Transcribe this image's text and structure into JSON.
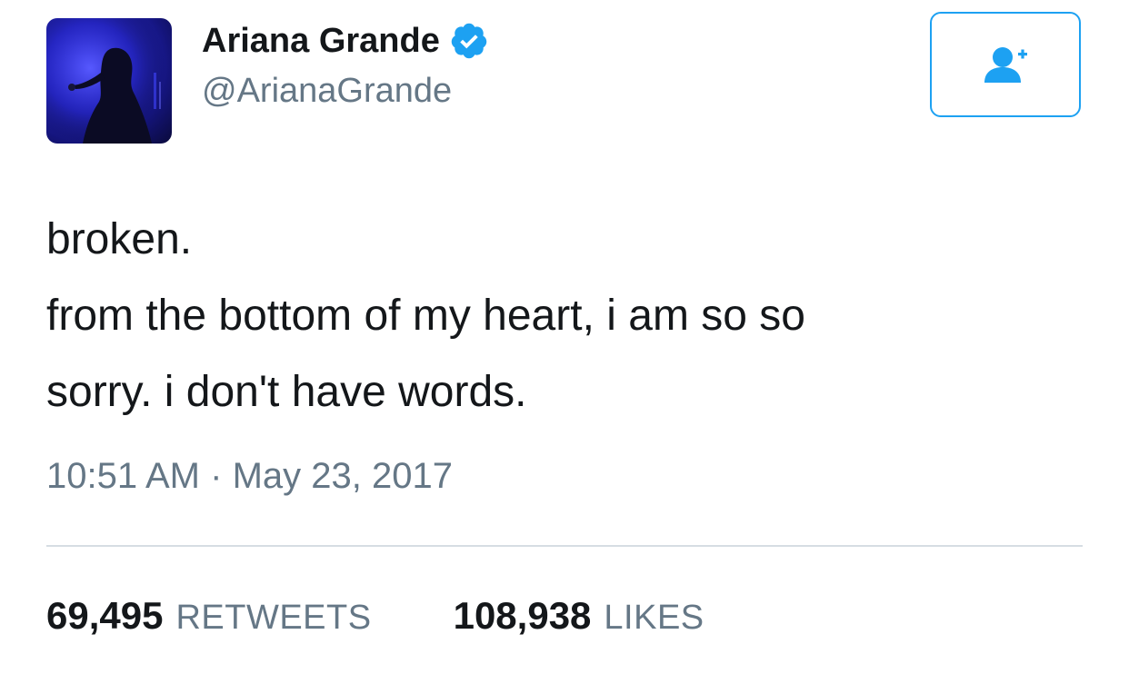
{
  "user": {
    "display_name": "Ariana Grande",
    "handle": "@ArianaGrande",
    "verified": true,
    "avatar_icon": "profile-photo"
  },
  "follow_button": {
    "icon": "follow-user-plus-icon",
    "color": "#1da1f2"
  },
  "tweet": {
    "lines": [
      "broken.",
      "from the bottom of my heart, i am so so",
      "sorry. i don't have words."
    ],
    "time": "10:51 AM",
    "separator": "·",
    "date": "May 23, 2017"
  },
  "stats": {
    "retweets_count": "69,495",
    "retweets_label": "RETWEETS",
    "likes_count": "108,938",
    "likes_label": "LIKES"
  },
  "colors": {
    "accent": "#1da1f2",
    "text_primary": "#14171a",
    "text_secondary": "#657786",
    "divider": "#d6dde3"
  }
}
